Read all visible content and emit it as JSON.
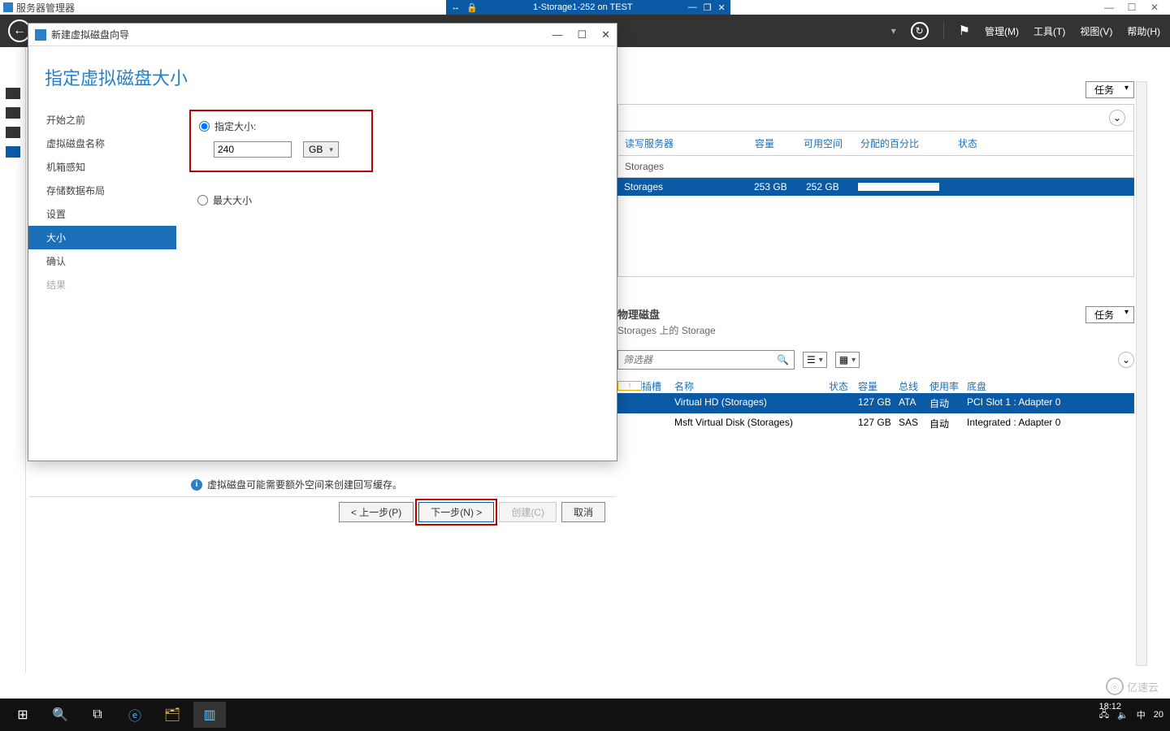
{
  "outer": {
    "app_title": "服务器管理器",
    "session_label": "1-Storage1-252 on TEST"
  },
  "toolbar": {
    "manage": "管理(M)",
    "tools": "工具(T)",
    "view": "视图(V)",
    "help": "帮助(H)"
  },
  "pools_panel": {
    "tasks_btn": "任务",
    "columns": {
      "server": "读写服务器",
      "capacity": "容量",
      "free": "可用空间",
      "alloc": "分配的百分比",
      "status": "状态"
    },
    "group_label": "Storages",
    "row": {
      "name": "Storages",
      "capacity": "253 GB",
      "free": "252 GB"
    }
  },
  "phys_panel": {
    "title": "物理磁盘",
    "subtitle": "Storages 上的 Storage",
    "tasks_btn": "任务",
    "filter_placeholder": "筛选器",
    "columns": {
      "warn": "⚠",
      "slot": "插槽",
      "name": "名称",
      "status": "状态",
      "capacity": "容量",
      "bus": "总线",
      "usage": "使用率",
      "chassis": "底盘"
    },
    "rows": [
      {
        "name": "Virtual HD (Storages)",
        "capacity": "127 GB",
        "bus": "ATA",
        "usage": "自动",
        "chassis": "PCI Slot 1 : Adapter 0"
      },
      {
        "name": "Msft Virtual Disk (Storages)",
        "capacity": "127 GB",
        "bus": "SAS",
        "usage": "自动",
        "chassis": "Integrated : Adapter 0"
      }
    ]
  },
  "wizard": {
    "window_title": "新建虚拟磁盘向导",
    "page_title": "指定虚拟磁盘大小",
    "steps": {
      "before": "开始之前",
      "name": "虚拟磁盘名称",
      "encl": "机箱感知",
      "layout": "存储数据布局",
      "settings": "设置",
      "size": "大小",
      "confirm": "确认",
      "result": "结果"
    },
    "opt_specify": "指定大小:",
    "size_value": "240",
    "unit_label": "GB",
    "opt_max": "最大大小",
    "hint": "虚拟磁盘可能需要额外空间来创建回写缓存。",
    "buttons": {
      "prev": "< 上一步(P)",
      "next": "下一步(N) >",
      "create": "创建(C)",
      "cancel": "取消"
    }
  },
  "tray": {
    "ime": "中",
    "clock": "18:12",
    "date_partial": "20"
  },
  "watermark": {
    "text": "亿速云"
  }
}
